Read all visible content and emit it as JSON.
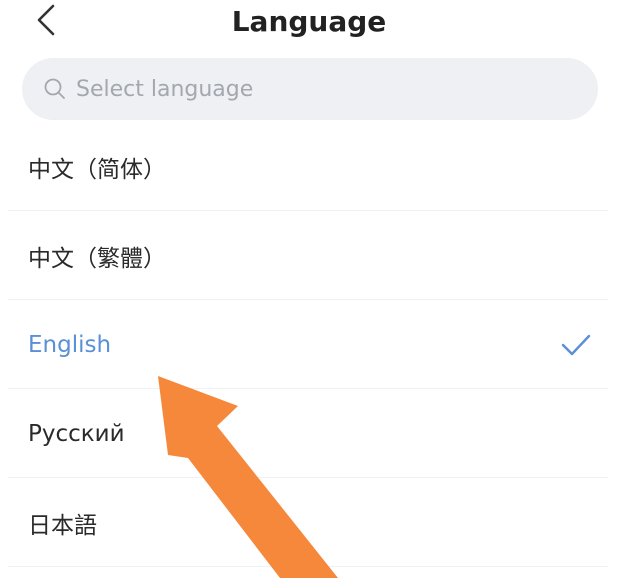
{
  "header": {
    "title": "Language",
    "back_icon": "chevron-left-icon"
  },
  "search": {
    "placeholder": "Select language",
    "value": "",
    "icon": "search-icon"
  },
  "languages": [
    {
      "label": "中文（简体）",
      "selected": false
    },
    {
      "label": "中文（繁體）",
      "selected": false
    },
    {
      "label": "English",
      "selected": true
    },
    {
      "label": "Русский",
      "selected": false
    },
    {
      "label": "日本語",
      "selected": false
    }
  ],
  "colors": {
    "accent": "#5b8fd6",
    "annotation_arrow": "#f5883a",
    "search_bg": "#eef0f4"
  },
  "annotation": {
    "type": "arrow",
    "points_to": "English"
  }
}
